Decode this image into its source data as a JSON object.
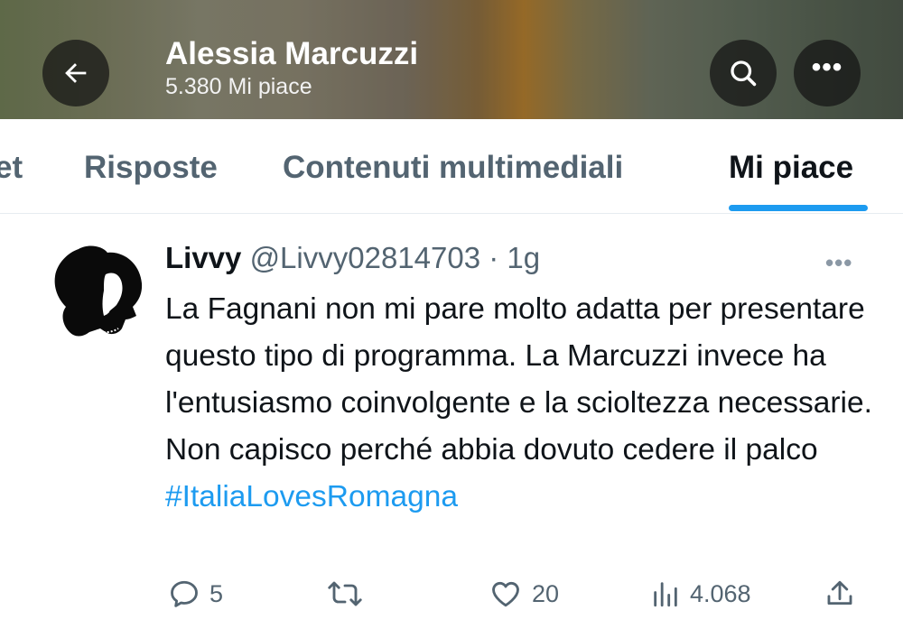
{
  "header": {
    "title": "Alessia Marcuzzi",
    "subtitle": "5.380 Mi piace",
    "back_icon": "arrow-left-icon",
    "search_icon": "search-icon",
    "more_icon": "more-dots-icon",
    "more_label": "•••"
  },
  "tabs": [
    {
      "label": "et"
    },
    {
      "label": "Risposte"
    },
    {
      "label": "Contenuti multimediali"
    },
    {
      "label": "Mi piace",
      "active": true
    }
  ],
  "tweet": {
    "author_name": "Livvy",
    "handle": "@Livvy02814703",
    "separator": "·",
    "time": "1g",
    "more_label": "•••",
    "text": "La Fagnani non mi pare molto adatta per presentare questo tipo di programma. La Marcuzzi invece ha l'entusiasmo coinvolgente e la scioltezza necessarie. Non capisco perché abbia dovuto cedere il palco ",
    "hashtag": "#ItaliaLovesRomagna",
    "actions": {
      "replies": "5",
      "retweets": "",
      "likes": "20",
      "views": "4.068"
    }
  },
  "colors": {
    "accent": "#1d9bf0",
    "text_primary": "#0f1419",
    "text_secondary": "#536471"
  }
}
